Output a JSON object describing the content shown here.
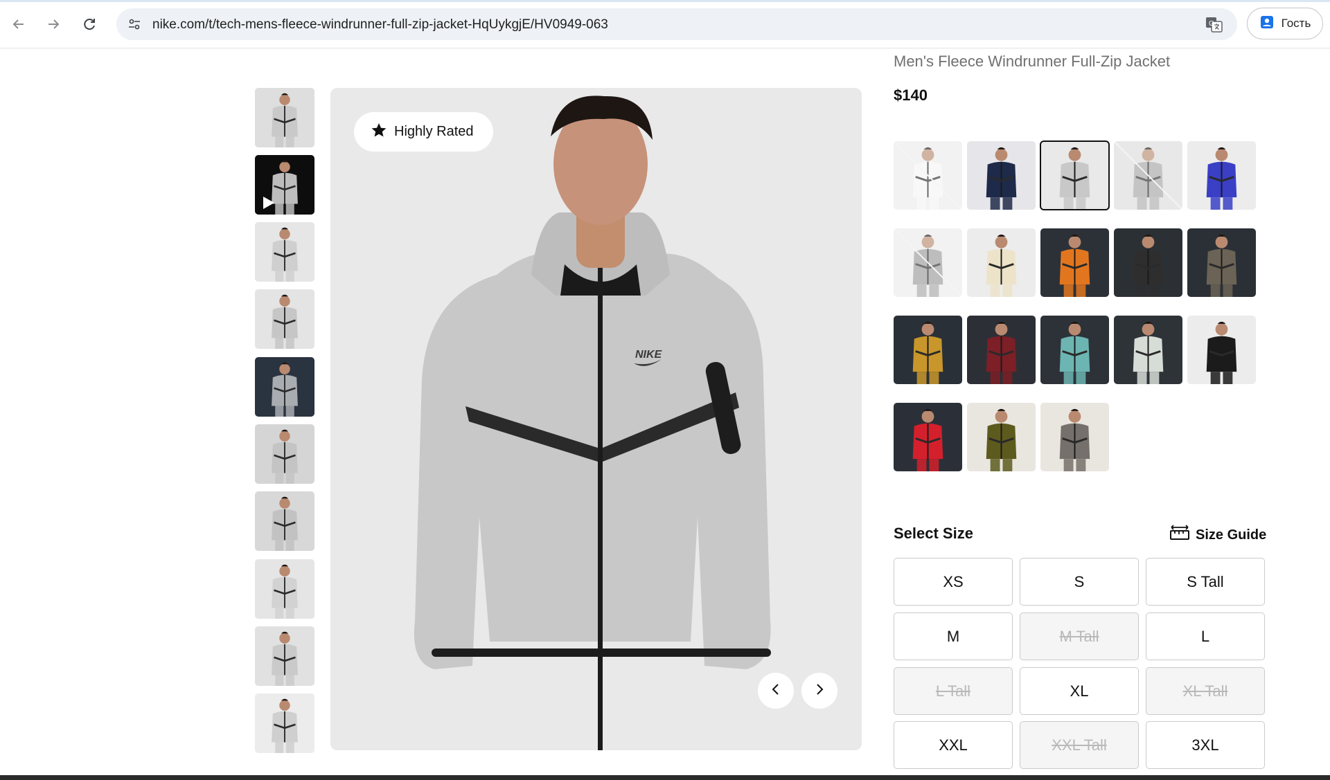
{
  "browser": {
    "url": "nike.com/t/tech-mens-fleece-windrunner-full-zip-jacket-HqUykgjE/HV0949-063",
    "profile_label": "Гость",
    "icons": [
      "back-arrow-icon",
      "forward-arrow-icon",
      "reload-icon",
      "site-info-icon",
      "translate-icon",
      "profile-icon"
    ]
  },
  "product": {
    "title": "Men's Fleece Windrunner Full-Zip Jacket",
    "price": "$140",
    "badge": "Highly Rated"
  },
  "thumbnails": [
    {
      "bg": "#dedede",
      "jacket": "#c9c9c9",
      "video": false
    },
    {
      "bg": "#0d0d0d",
      "jacket": "#bdbdbd",
      "video": true
    },
    {
      "bg": "#e6e6e6",
      "jacket": "#cfcfcf",
      "video": false
    },
    {
      "bg": "#e4e4e4",
      "jacket": "#c6c6c6",
      "video": false
    },
    {
      "bg": "#2a3340",
      "jacket": "#a9adb2",
      "video": false
    },
    {
      "bg": "#d5d5d5",
      "jacket": "#c4c4c4",
      "video": false
    },
    {
      "bg": "#d8d8d8",
      "jacket": "#c2c2c2",
      "video": false
    },
    {
      "bg": "#e5e5e5",
      "jacket": "#d2d2d2",
      "video": false
    },
    {
      "bg": "#e1e1e1",
      "jacket": "#cacaca",
      "video": false
    },
    {
      "bg": "#ececec",
      "jacket": "#cfcfcf",
      "video": false
    }
  ],
  "colorways": [
    {
      "bg": "#ececec",
      "jacket": "#f4f4f4",
      "available": false,
      "selected": false
    },
    {
      "bg": "#e6e6ea",
      "jacket": "#1e2a4a",
      "available": true,
      "selected": false
    },
    {
      "bg": "#e9e9e9",
      "jacket": "#c8c8c8",
      "available": true,
      "selected": true
    },
    {
      "bg": "#dcdcdc",
      "jacket": "#a5a5a5",
      "available": false,
      "selected": false
    },
    {
      "bg": "#ececec",
      "jacket": "#3a3fc6",
      "available": true,
      "selected": false
    },
    {
      "bg": "#ececec",
      "jacket": "#9a9a9a",
      "available": false,
      "selected": false
    },
    {
      "bg": "#ececec",
      "jacket": "#ece3c9",
      "available": true,
      "selected": false
    },
    {
      "bg": "#2c3138",
      "jacket": "#e2761f",
      "available": true,
      "selected": false
    },
    {
      "bg": "#2b3035",
      "jacket": "#2e2e2e",
      "available": true,
      "selected": false
    },
    {
      "bg": "#2a3036",
      "jacket": "#6b6355",
      "available": true,
      "selected": false
    },
    {
      "bg": "#2a3038",
      "jacket": "#c8962a",
      "available": true,
      "selected": false
    },
    {
      "bg": "#2c3036",
      "jacket": "#7c1f26",
      "available": true,
      "selected": false
    },
    {
      "bg": "#2d3238",
      "jacket": "#6cb5b2",
      "available": true,
      "selected": false
    },
    {
      "bg": "#2e3338",
      "jacket": "#d6ddd6",
      "available": true,
      "selected": false
    },
    {
      "bg": "#ececec",
      "jacket": "#1b1b1b",
      "available": true,
      "selected": false
    },
    {
      "bg": "#2b3038",
      "jacket": "#d4202c",
      "available": true,
      "selected": false
    },
    {
      "bg": "#e8e6df",
      "jacket": "#5d5a1e",
      "available": true,
      "selected": false
    },
    {
      "bg": "#e8e6df",
      "jacket": "#75706b",
      "available": true,
      "selected": false
    }
  ],
  "sizes": {
    "heading": "Select Size",
    "guide_label": "Size Guide",
    "options": [
      {
        "label": "XS",
        "available": true
      },
      {
        "label": "S",
        "available": true
      },
      {
        "label": "S Tall",
        "available": true
      },
      {
        "label": "M",
        "available": true
      },
      {
        "label": "M Tall",
        "available": false
      },
      {
        "label": "L",
        "available": true
      },
      {
        "label": "L Tall",
        "available": false
      },
      {
        "label": "XL",
        "available": true
      },
      {
        "label": "XL Tall",
        "available": false
      },
      {
        "label": "XXL",
        "available": true
      },
      {
        "label": "XXL Tall",
        "available": false
      },
      {
        "label": "3XL",
        "available": true
      }
    ]
  }
}
